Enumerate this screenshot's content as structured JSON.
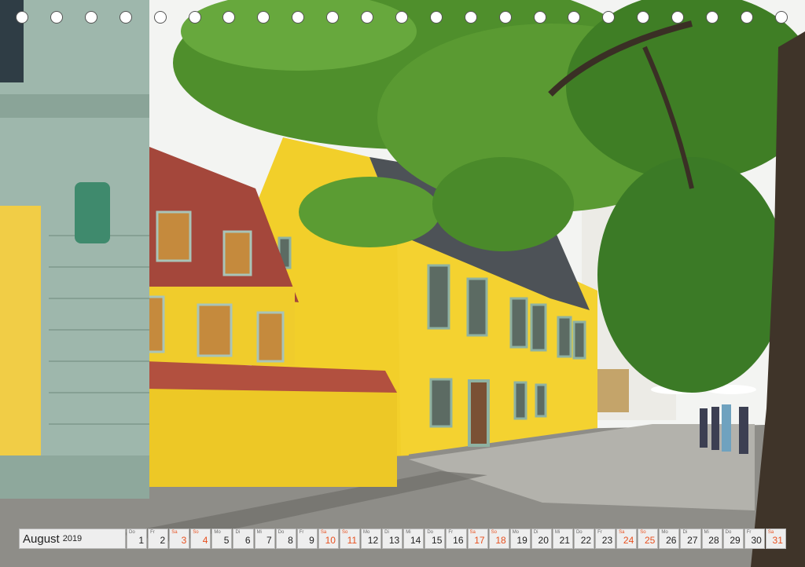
{
  "calendar": {
    "month": "August",
    "year": "2019",
    "days": [
      {
        "wd": "Do",
        "d": "1",
        "hi": false
      },
      {
        "wd": "Fr",
        "d": "2",
        "hi": false
      },
      {
        "wd": "Sa",
        "d": "3",
        "hi": true
      },
      {
        "wd": "So",
        "d": "4",
        "hi": true
      },
      {
        "wd": "Mo",
        "d": "5",
        "hi": false
      },
      {
        "wd": "Di",
        "d": "6",
        "hi": false
      },
      {
        "wd": "Mi",
        "d": "7",
        "hi": false
      },
      {
        "wd": "Do",
        "d": "8",
        "hi": false
      },
      {
        "wd": "Fr",
        "d": "9",
        "hi": false
      },
      {
        "wd": "Sa",
        "d": "10",
        "hi": true
      },
      {
        "wd": "So",
        "d": "11",
        "hi": true
      },
      {
        "wd": "Mo",
        "d": "12",
        "hi": false
      },
      {
        "wd": "Di",
        "d": "13",
        "hi": false
      },
      {
        "wd": "Mi",
        "d": "14",
        "hi": false
      },
      {
        "wd": "Do",
        "d": "15",
        "hi": false
      },
      {
        "wd": "Fr",
        "d": "16",
        "hi": false
      },
      {
        "wd": "Sa",
        "d": "17",
        "hi": true
      },
      {
        "wd": "So",
        "d": "18",
        "hi": true
      },
      {
        "wd": "Mo",
        "d": "19",
        "hi": false
      },
      {
        "wd": "Di",
        "d": "20",
        "hi": false
      },
      {
        "wd": "Mi",
        "d": "21",
        "hi": false
      },
      {
        "wd": "Do",
        "d": "22",
        "hi": false
      },
      {
        "wd": "Fr",
        "d": "23",
        "hi": false
      },
      {
        "wd": "Sa",
        "d": "24",
        "hi": true
      },
      {
        "wd": "So",
        "d": "25",
        "hi": true
      },
      {
        "wd": "Mo",
        "d": "26",
        "hi": false
      },
      {
        "wd": "Di",
        "d": "27",
        "hi": false
      },
      {
        "wd": "Mi",
        "d": "28",
        "hi": false
      },
      {
        "wd": "Do",
        "d": "29",
        "hi": false
      },
      {
        "wd": "Fr",
        "d": "30",
        "hi": false
      },
      {
        "wd": "Sa",
        "d": "31",
        "hi": true
      }
    ]
  },
  "colors": {
    "weekend": "#e8501f",
    "house_yellow": "#f2cf2a",
    "mint": "#9fb8ad",
    "roof": "#a4473b"
  },
  "binding_holes": 23
}
